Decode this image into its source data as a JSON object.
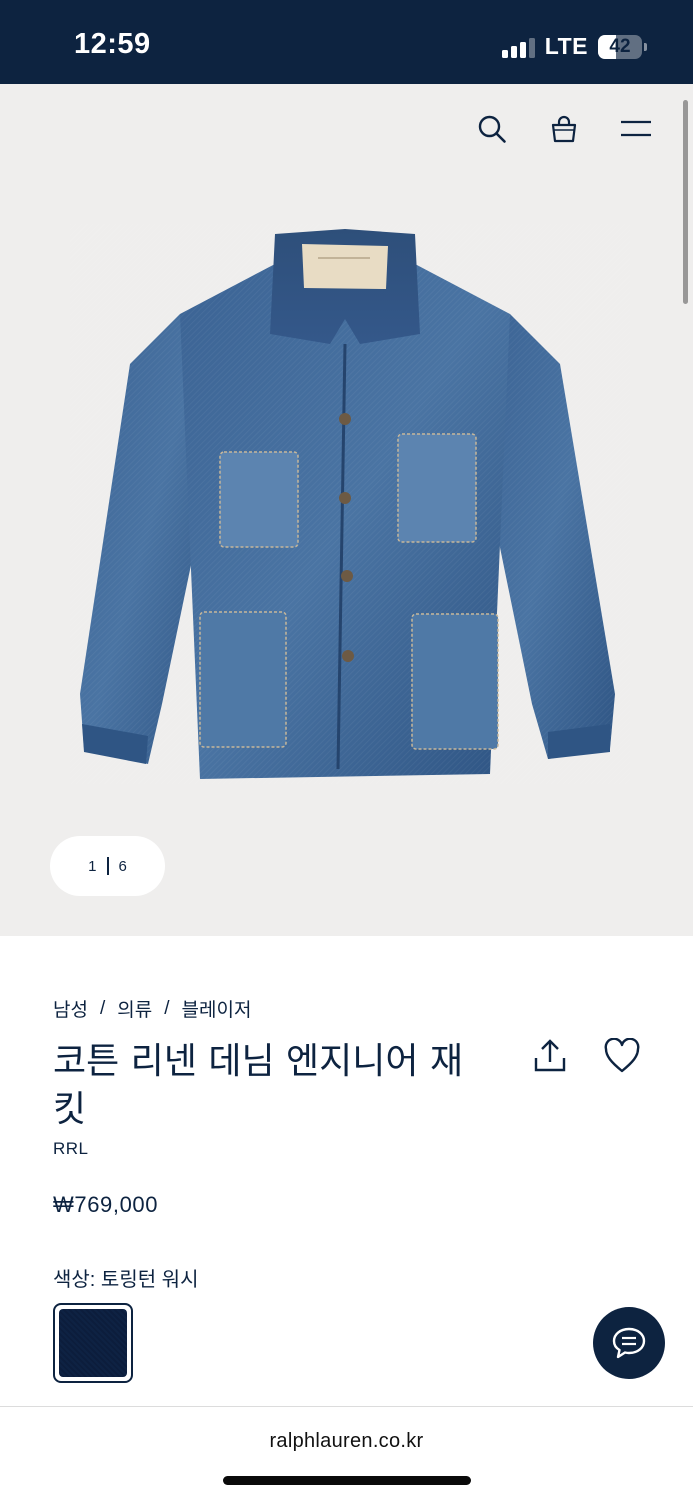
{
  "status_bar": {
    "time": "12:59",
    "network": "LTE",
    "battery": "42",
    "battery_level": 0.42
  },
  "header": {
    "icons": [
      "search-icon",
      "shopping-bag-icon",
      "menu-icon"
    ]
  },
  "gallery": {
    "current_index": "1",
    "total": "6"
  },
  "product": {
    "breadcrumb": [
      "남성",
      "의류",
      "블레이저"
    ],
    "breadcrumb_separator": "/",
    "title": "코튼 리넨 데님 엔지니어 재킷",
    "brand": "RRL",
    "price": "₩769,000",
    "color_label": "색상: 토링턴 워시",
    "swatch_color": "#3b5b80"
  },
  "browser": {
    "url": "ralphlauren.co.kr"
  },
  "colors": {
    "navy": "#0d2340",
    "image_bg": "#efeeed"
  }
}
